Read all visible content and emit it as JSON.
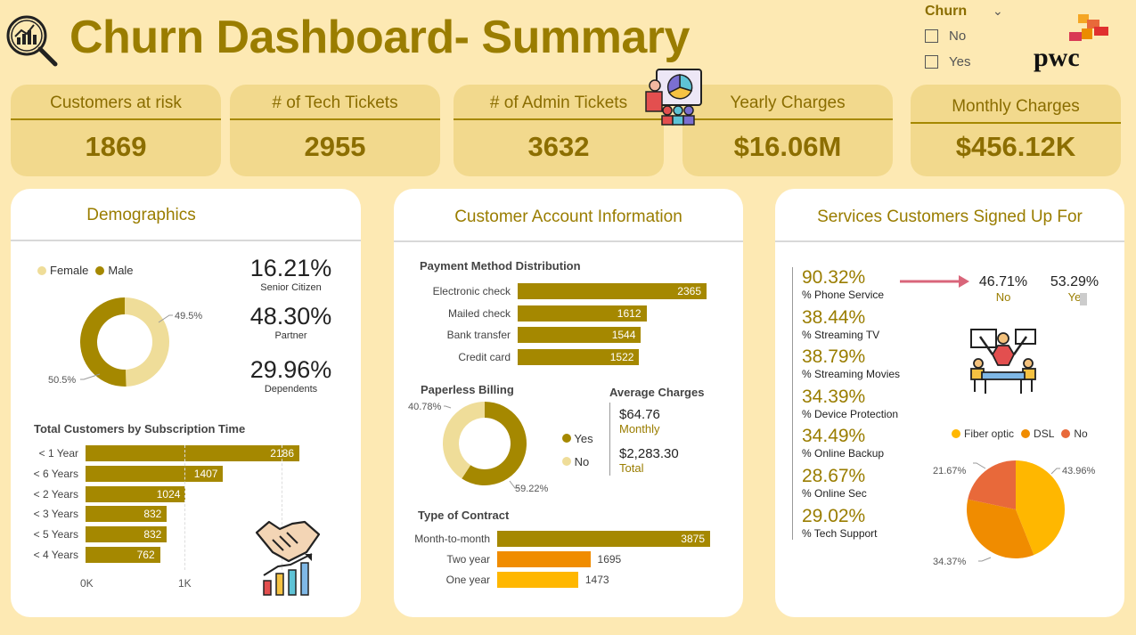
{
  "header": {
    "title": "Churn Dashboard- Summary",
    "logo": "pwc"
  },
  "filter": {
    "label": "Churn",
    "options": [
      "No",
      "Yes"
    ]
  },
  "kpis": [
    {
      "label": "Customers at risk",
      "value": "1869"
    },
    {
      "label": "# of Tech Tickets",
      "value": "2955"
    },
    {
      "label": "# of Admin Tickets",
      "value": "3632"
    },
    {
      "label": "Yearly Charges",
      "value": "$16.06M"
    },
    {
      "label": "Monthly Charges",
      "value": "$456.12K"
    }
  ],
  "demographics": {
    "title": "Demographics",
    "legend": [
      "Female",
      "Male"
    ],
    "donut_labels": [
      "49.5%",
      "50.5%"
    ],
    "stats": [
      {
        "value": "16.21%",
        "label": "Senior Citizen"
      },
      {
        "value": "48.30%",
        "label": "Partner"
      },
      {
        "value": "29.96%",
        "label": "Dependents"
      }
    ],
    "subscription_title": "Total Customers by Subscription Time",
    "axis": [
      "0K",
      "1K"
    ]
  },
  "account": {
    "title": "Customer Account Information",
    "payment_title": "Payment Method Distribution",
    "paperless_title": "Paperless Billing",
    "paperless_legend": [
      "Yes",
      "No"
    ],
    "paperless_labels": [
      "40.78%",
      "59.22%"
    ],
    "avg_title": "Average Charges",
    "avg_monthly": "$64.76",
    "avg_monthly_label": "Monthly",
    "avg_total": "$2,283.30",
    "avg_total_label": "Total",
    "contract_title": "Type of Contract"
  },
  "services": {
    "title": "Services Customers Signed Up For",
    "items": [
      {
        "value": "90.32%",
        "label": "% Phone Service"
      },
      {
        "value": "38.44%",
        "label": "% Streaming TV"
      },
      {
        "value": "38.79%",
        "label": "% Streaming Movies"
      },
      {
        "value": "34.39%",
        "label": "% Device Protection"
      },
      {
        "value": "34.49%",
        "label": "% Online Backup"
      },
      {
        "value": "28.67%",
        "label": "% Online Sec"
      },
      {
        "value": "29.02%",
        "label": "% Tech Support"
      }
    ],
    "phone_split": [
      {
        "value": "46.71%",
        "label": "No"
      },
      {
        "value": "53.29%",
        "label": "Ye"
      }
    ],
    "internet_legend": [
      "Fiber optic",
      "DSL",
      "No"
    ],
    "internet_labels": [
      "21.67%",
      "43.96%",
      "34.37%"
    ]
  },
  "colors": {
    "gold": "#a58800",
    "orange": "#f08c00",
    "yellow": "#ffb700",
    "red_orange": "#e8693a",
    "light": "#efdd99",
    "bg": "#fde9b3"
  },
  "chart_data": [
    {
      "type": "pie",
      "title": "Demographics",
      "categories": [
        "Female",
        "Male"
      ],
      "values": [
        49.5,
        50.5
      ]
    },
    {
      "type": "bar",
      "title": "Total Customers by Subscription Time",
      "categories": [
        "< 1 Year",
        "< 6 Years",
        "< 2 Years",
        "< 3 Years",
        "< 5 Years",
        "< 4 Years"
      ],
      "values": [
        2186,
        1407,
        1024,
        832,
        832,
        762
      ],
      "xlim": [
        0,
        1800
      ]
    },
    {
      "type": "bar",
      "title": "Payment Method Distribution",
      "categories": [
        "Electronic check",
        "Mailed check",
        "Bank transfer",
        "Credit card"
      ],
      "values": [
        2365,
        1612,
        1544,
        1522
      ]
    },
    {
      "type": "pie",
      "title": "Paperless Billing",
      "categories": [
        "Yes",
        "No"
      ],
      "values": [
        59.22,
        40.78
      ]
    },
    {
      "type": "bar",
      "title": "Type of Contract",
      "categories": [
        "Month-to-month",
        "Two year",
        "One year"
      ],
      "values": [
        3875,
        1695,
        1473
      ]
    },
    {
      "type": "pie",
      "categories": [
        "Fiber optic",
        "DSL",
        "No"
      ],
      "values": [
        43.96,
        34.37,
        21.67
      ]
    }
  ]
}
